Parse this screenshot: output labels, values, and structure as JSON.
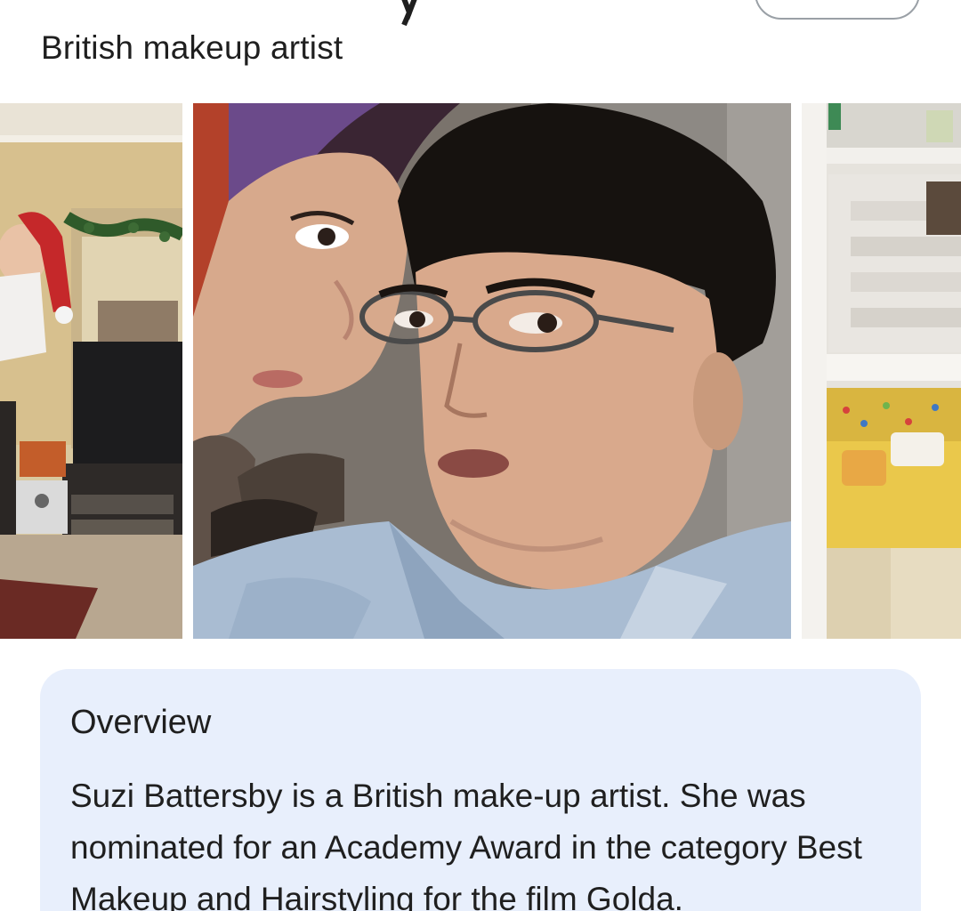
{
  "header": {
    "subtitle": "British makeup artist"
  },
  "carousel": {
    "images": [
      {
        "name": "living-room-christmas-scene"
      },
      {
        "name": "two-people-close-up-scene"
      },
      {
        "name": "shop-shelf-scene"
      }
    ]
  },
  "overview": {
    "heading": "Overview",
    "text": "Suzi Battersby is a British make-up artist. She was nominated for an Academy Award in the category Best Makeup and Hairstyling for the film Golda."
  }
}
